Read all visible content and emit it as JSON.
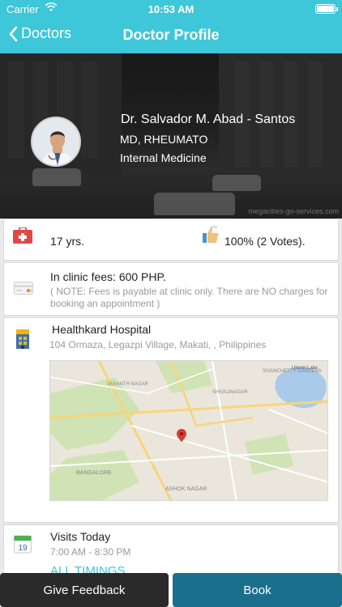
{
  "status_bar": {
    "carrier": "Carrier",
    "time": "10:53 AM"
  },
  "nav": {
    "back_label": "Doctors",
    "title": "Doctor Profile"
  },
  "doctor": {
    "name": "Dr. Salvador M. Abad - Santos",
    "degree": "MD, RHEUMATO",
    "specialty": "Internal Medicine",
    "banner_watermark": "megacities-go-services.com"
  },
  "stats": {
    "experience": "17 yrs.",
    "votes": "100% (2 Votes)."
  },
  "fees": {
    "title": "In clinic  fees: 600 PHP.",
    "note": "( NOTE: Fees is payable at clinic only. There are NO charges for booking an appointment )"
  },
  "hospital": {
    "name": "Healthkard Hospital",
    "address": "104 Ormaza, Legazpi Village, Makati, , Philippines",
    "map_labels": [
      "BANGALORE",
      "SIVANCHETTY GARDENS",
      "ASHOK NAGAR",
      "VASANTH NAGAR",
      "SHIVAJINAGAR",
      "Ulsoor Lake"
    ]
  },
  "visits": {
    "title": "Visits Today",
    "hours": "7:00 AM - 8:30 PM",
    "all_timings": "ALL TIMINGS"
  },
  "calendar_icon_day": "19",
  "actions": {
    "feedback": "Give Feedback",
    "book": "Book"
  },
  "colors": {
    "accent": "#3ec6d9",
    "book_button": "#1a6f8c",
    "feedback_button": "#2a2a2a"
  }
}
